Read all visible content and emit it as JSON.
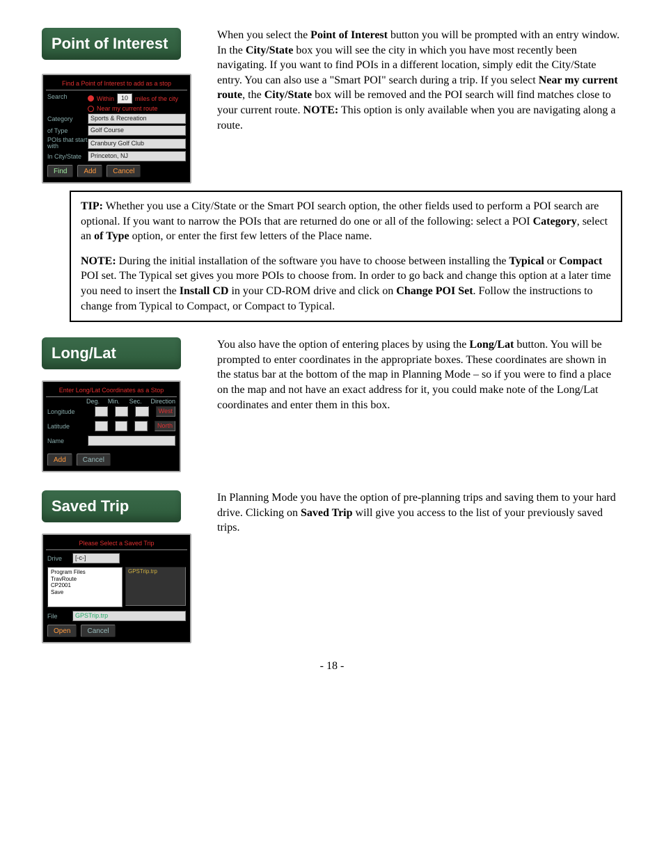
{
  "headers": {
    "poi": "Point of Interest",
    "longlat": "Long/Lat",
    "saved": "Saved Trip"
  },
  "poi_panel": {
    "title": "Find a Point of Interest to add as a stop",
    "search_label": "Search",
    "radio_within_pre": "Within",
    "radio_within_value": "10",
    "radio_within_post": "miles of the city",
    "radio_near": "Near my current route",
    "category_label": "Category",
    "category_value": "Sports & Recreation",
    "type_label": "of Type",
    "type_value": "Golf Course",
    "pois_label": "POIs that start with",
    "pois_value": "Cranbury Golf Club",
    "city_label": "In City/State",
    "city_value": "Princeton, NJ",
    "find_btn": "Find",
    "add_btn": "Add",
    "cancel_btn": "Cancel"
  },
  "poi_text": {
    "line": "When you select the ",
    "bold1": "Point of Interest",
    "line2": " button you will be prompted with an entry window.  In the ",
    "bold2": "City/State",
    "line3": " box you will see the city in which you have most recently been navigating.  If you want to find POIs in a different location, simply edit the City/State entry.  You can also use a \"Smart POI\" search during a trip.  If you select ",
    "bold3": "Near my current route",
    "line4": ", the ",
    "bold4": "City/State",
    "line5": " box will be removed and the POI search will find matches close to your current route.  ",
    "note_label": "NOTE:",
    "note": " This option is only available when you are navigating along a route."
  },
  "tip_box": {
    "tip_label": "TIP:",
    "tip_text": " Whether you use a City/State or the Smart POI search option, the other fields used to perform a POI search are optional.  If you want to narrow the POIs that are returned do one or all of the following: select a POI ",
    "bold1": "Category",
    "tip_text2": ", select an ",
    "bold2": "of Type",
    "tip_text3": " option, or enter the first few letters of the Place name.",
    "note_label": "NOTE:",
    "note1": " During the initial installation of the software you have to choose between installing the ",
    "bold3": "Typical",
    "note2": " or ",
    "bold4": "Compact",
    "note3": " POI set.  The Typical set gives you more POIs to choose from.  In order to go back and change this option at a later time you need to insert the ",
    "bold5": "Install CD",
    "note4": " in your CD-ROM drive and click on ",
    "bold6": "Change POI Set",
    "note5": ".  Follow the instructions to change from Typical to Compact, or Compact to Typical."
  },
  "longlat_panel": {
    "title": "Enter Long/Lat Coordinates as a Stop",
    "deg": "Deg.",
    "min": "Min.",
    "sec": "Sec.",
    "dir": "Direction",
    "long_label": "Longitude",
    "long_dir": "West",
    "lat_label": "Latitude",
    "lat_dir": "North",
    "name_label": "Name",
    "add_btn": "Add",
    "cancel_btn": "Cancel"
  },
  "longlat_text": {
    "line1": "You also have the option of entering places by using the ",
    "bold1": "Long/Lat",
    "line2": " button.  You will be prompted to enter coordinates in the appropriate boxes.  These coordinates are shown in the status bar at the bottom of the map in Planning Mode – so if you were to find a place on the map and not have an exact address for it, you could make note of the Long/Lat coordinates and enter them in this box."
  },
  "saved_panel": {
    "title": "Please Select a Saved Trip",
    "drive_label": "Drive",
    "drive_value": "[-c-]",
    "tree_items": [
      "Program Files",
      "TravRoute",
      "CP2001",
      "Save"
    ],
    "preview_label": "GPSTrip.trp",
    "file_label": "File",
    "file_value": "GPSTrip.trp",
    "open_btn": "Open",
    "cancel_btn": "Cancel"
  },
  "saved_text": {
    "line1": "In Planning Mode you have the option of pre-planning trips and saving them to your hard drive.  Clicking on ",
    "bold1": "Saved Trip",
    "line2": " will give you access to the list of your previously saved trips."
  },
  "page_number": "- 18 -"
}
